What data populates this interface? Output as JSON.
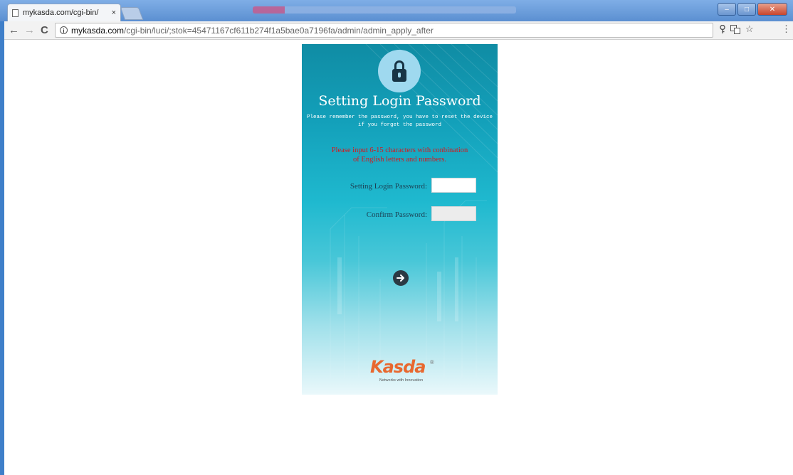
{
  "browser": {
    "tab_title": "mykasda.com/cgi-bin/",
    "tab_close": "×",
    "url_host": "mykasda.com",
    "url_path": "/cgi-bin/luci/;stok=45471167cf611b274f1a5bae0a7196fa/admin/admin_apply_after",
    "nav": {
      "back": "←",
      "forward": "→",
      "reload": "C"
    },
    "toolbar_icons": {
      "menu": "⋮",
      "bookmark": "☆"
    },
    "window_controls": {
      "minimize": "–",
      "maximize": "□",
      "close": "✕"
    }
  },
  "page": {
    "title": "Setting Login Password",
    "notice_line1": "Please remember the password, you have to reset the device",
    "notice_line2": "if you forget the password",
    "warning_line1": "Please input 6-15 characters with conbination",
    "warning_line2": "of English letters and numbers.",
    "password_label": "Setting Login Password:",
    "confirm_label": "Confirm Password:",
    "password_value": "",
    "confirm_value": "",
    "logo_text": "Kasda",
    "logo_registered": "®",
    "tagline": "Networks with Innovation"
  },
  "icons": {
    "lock": "lock-icon",
    "next": "arrow-right-icon",
    "info": "info-icon"
  },
  "colors": {
    "accent": "#13a0ba",
    "warning": "#d8161b",
    "logo": "#e8682f"
  }
}
